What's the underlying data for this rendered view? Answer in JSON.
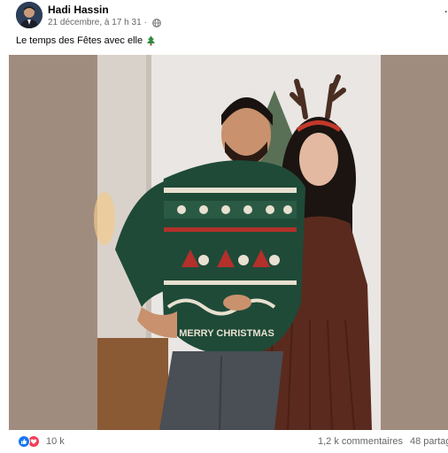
{
  "post": {
    "author_name": "Hadi Hassin",
    "timestamp": "21 décembre, à 17 h 31",
    "meta_separator": "·",
    "more_menu_glyph": "·",
    "caption_text": "Le temps des Fêtes avec elle",
    "caption_icon": "christmas-tree-icon",
    "privacy_icon": "globe-icon"
  },
  "photo": {
    "sweater_text": "MERRY CHRISTMAS",
    "background_color": "#a08c7f"
  },
  "footer": {
    "reaction_icons": [
      "like-icon",
      "love-icon"
    ],
    "reaction_count": "10 k",
    "comments_count": "1,2 k commentaires",
    "shares_count": "48 partag"
  },
  "colors": {
    "like_blue": "#1877f2",
    "love_red": "#f33e58",
    "secondary_text": "#65676b"
  }
}
